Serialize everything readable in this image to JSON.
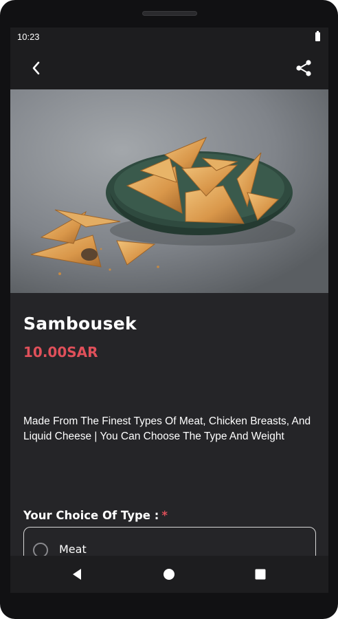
{
  "status_bar": {
    "time": "10:23"
  },
  "app_bar": {
    "back_icon": "chevron-left-icon",
    "share_icon": "share-icon"
  },
  "product": {
    "name": "Sambousek",
    "price": "10.00SAR",
    "description": "Made From The Finest Types Of Meat, Chicken Breasts, And Liquid Cheese | You Can Choose The Type And Weight",
    "image": "sambousek-photo"
  },
  "choice": {
    "label": "Your Choice Of Type :",
    "required_marker": "*",
    "options": [
      {
        "label": "Meat",
        "selected": false
      }
    ]
  },
  "nav": {
    "back_icon": "triangle-back-icon",
    "home_icon": "circle-home-icon",
    "recent_icon": "square-recents-icon"
  },
  "colors": {
    "accent": "#e0505a",
    "background": "#252528",
    "bar": "#1d1d1f"
  }
}
